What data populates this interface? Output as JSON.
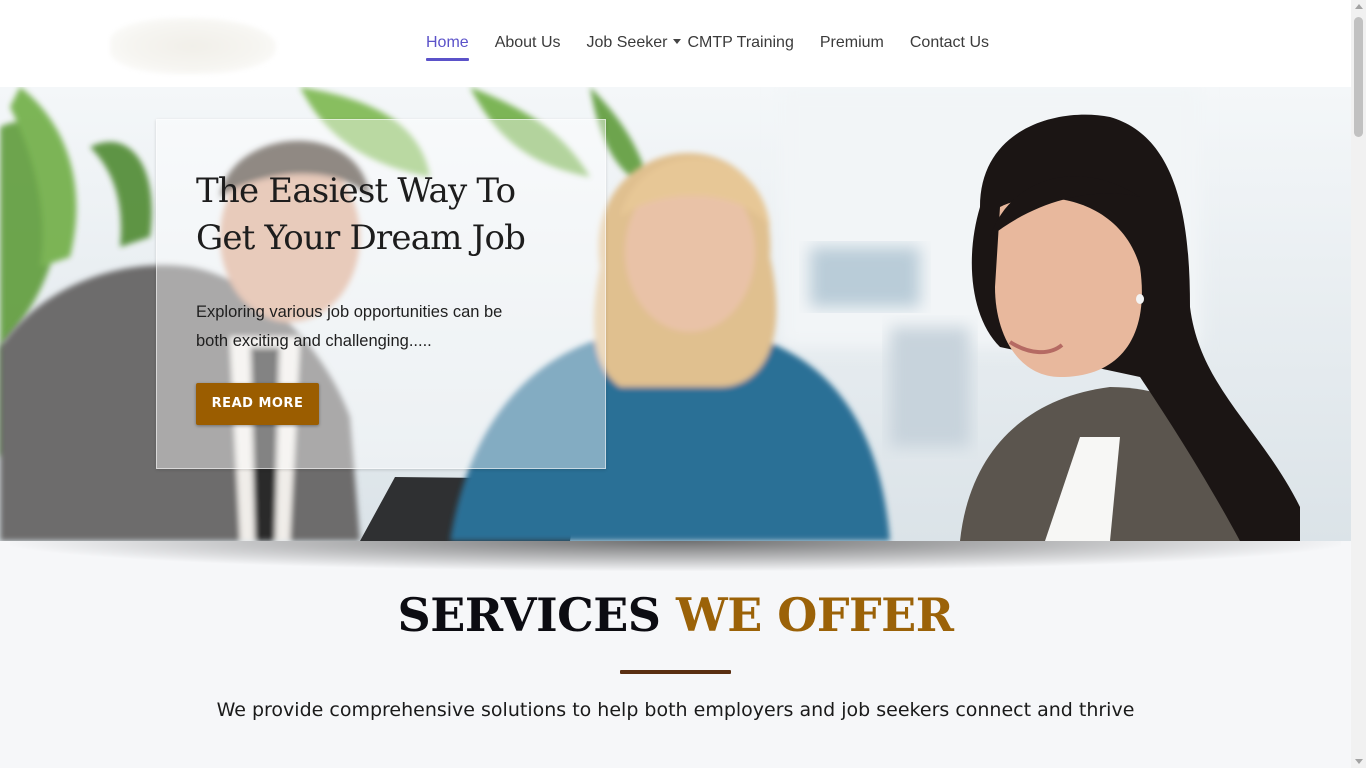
{
  "nav": {
    "items": [
      {
        "label": "Home",
        "active": true
      },
      {
        "label": "About Us"
      },
      {
        "label": "Job Seeker",
        "dropdown": true
      },
      {
        "label": "CMTP Training"
      },
      {
        "label": "Premium"
      },
      {
        "label": "Contact Us"
      }
    ]
  },
  "hero": {
    "title_line1": "The Easiest Way To",
    "title_line2": "Get Your Dream Job",
    "text_line1": "Exploring various job opportunities can be",
    "text_line2": "both exciting and challenging.....",
    "button_label": "READ MORE"
  },
  "services": {
    "title_dark": "SERVICES",
    "title_accent": "WE OFFER",
    "subtitle": "We provide comprehensive solutions to help both employers and job seekers connect and thrive"
  },
  "colors": {
    "accent": "#5b52c9",
    "brand_gold": "#9b6208",
    "button": "#9b5d00",
    "divider": "#5a2f12"
  },
  "icons": {
    "nav_dropdown": "caret-down-icon",
    "scroll_up": "scroll-up-arrow-icon",
    "scroll_down": "scroll-down-arrow-icon"
  }
}
